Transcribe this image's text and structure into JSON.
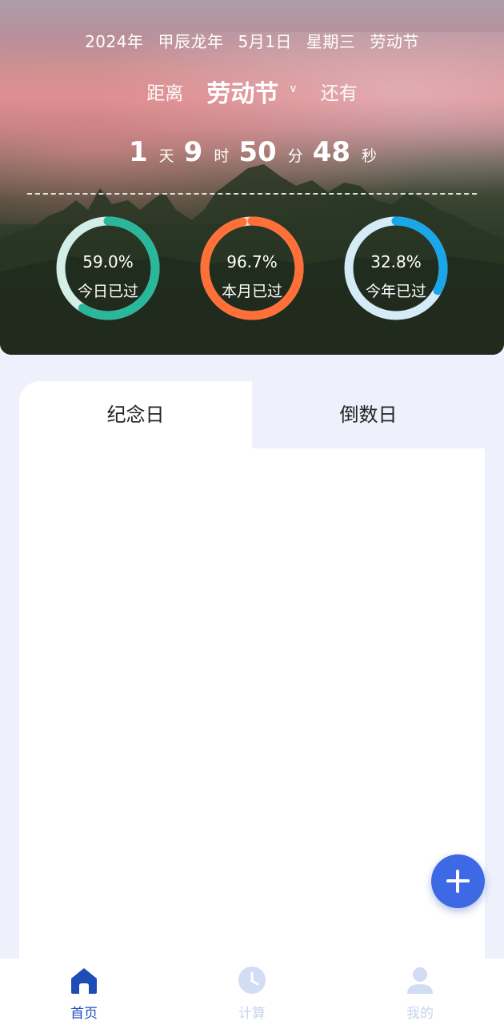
{
  "header": {
    "year": "2024年",
    "lunar_year": "甲辰龙年",
    "date": "5月1日",
    "weekday": "星期三",
    "festival": "劳动节"
  },
  "target": {
    "prefix": "距离",
    "name": "劳动节",
    "suffix": "还有"
  },
  "countdown": {
    "days": "1",
    "days_unit": "天",
    "hours": "9",
    "hours_unit": "时",
    "minutes": "50",
    "minutes_unit": "分",
    "seconds": "48",
    "seconds_unit": "秒"
  },
  "progress": [
    {
      "percent": "59.0%",
      "label": "今日已过",
      "fraction": 0.59,
      "color": "#2bb79a",
      "track": "#d3eee7"
    },
    {
      "percent": "96.7%",
      "label": "本月已过",
      "fraction": 0.967,
      "color": "#ff7038",
      "track": "#ffd9c8"
    },
    {
      "percent": "32.8%",
      "label": "今年已过",
      "fraction": 0.328,
      "color": "#1aa7ea",
      "track": "#d5ecf8"
    }
  ],
  "tabs": [
    {
      "label": "纪念日",
      "active": true
    },
    {
      "label": "倒数日",
      "active": false
    }
  ],
  "nav": [
    {
      "label": "首页",
      "icon": "home-icon",
      "active": true
    },
    {
      "label": "计算",
      "icon": "clock-icon",
      "active": false
    },
    {
      "label": "我的",
      "icon": "user-icon",
      "active": false
    }
  ],
  "colors": {
    "accent": "#3e69e4",
    "nav_active": "#1f4db8",
    "nav_inactive": "#c9d3ee",
    "background": "#eef1fb"
  }
}
